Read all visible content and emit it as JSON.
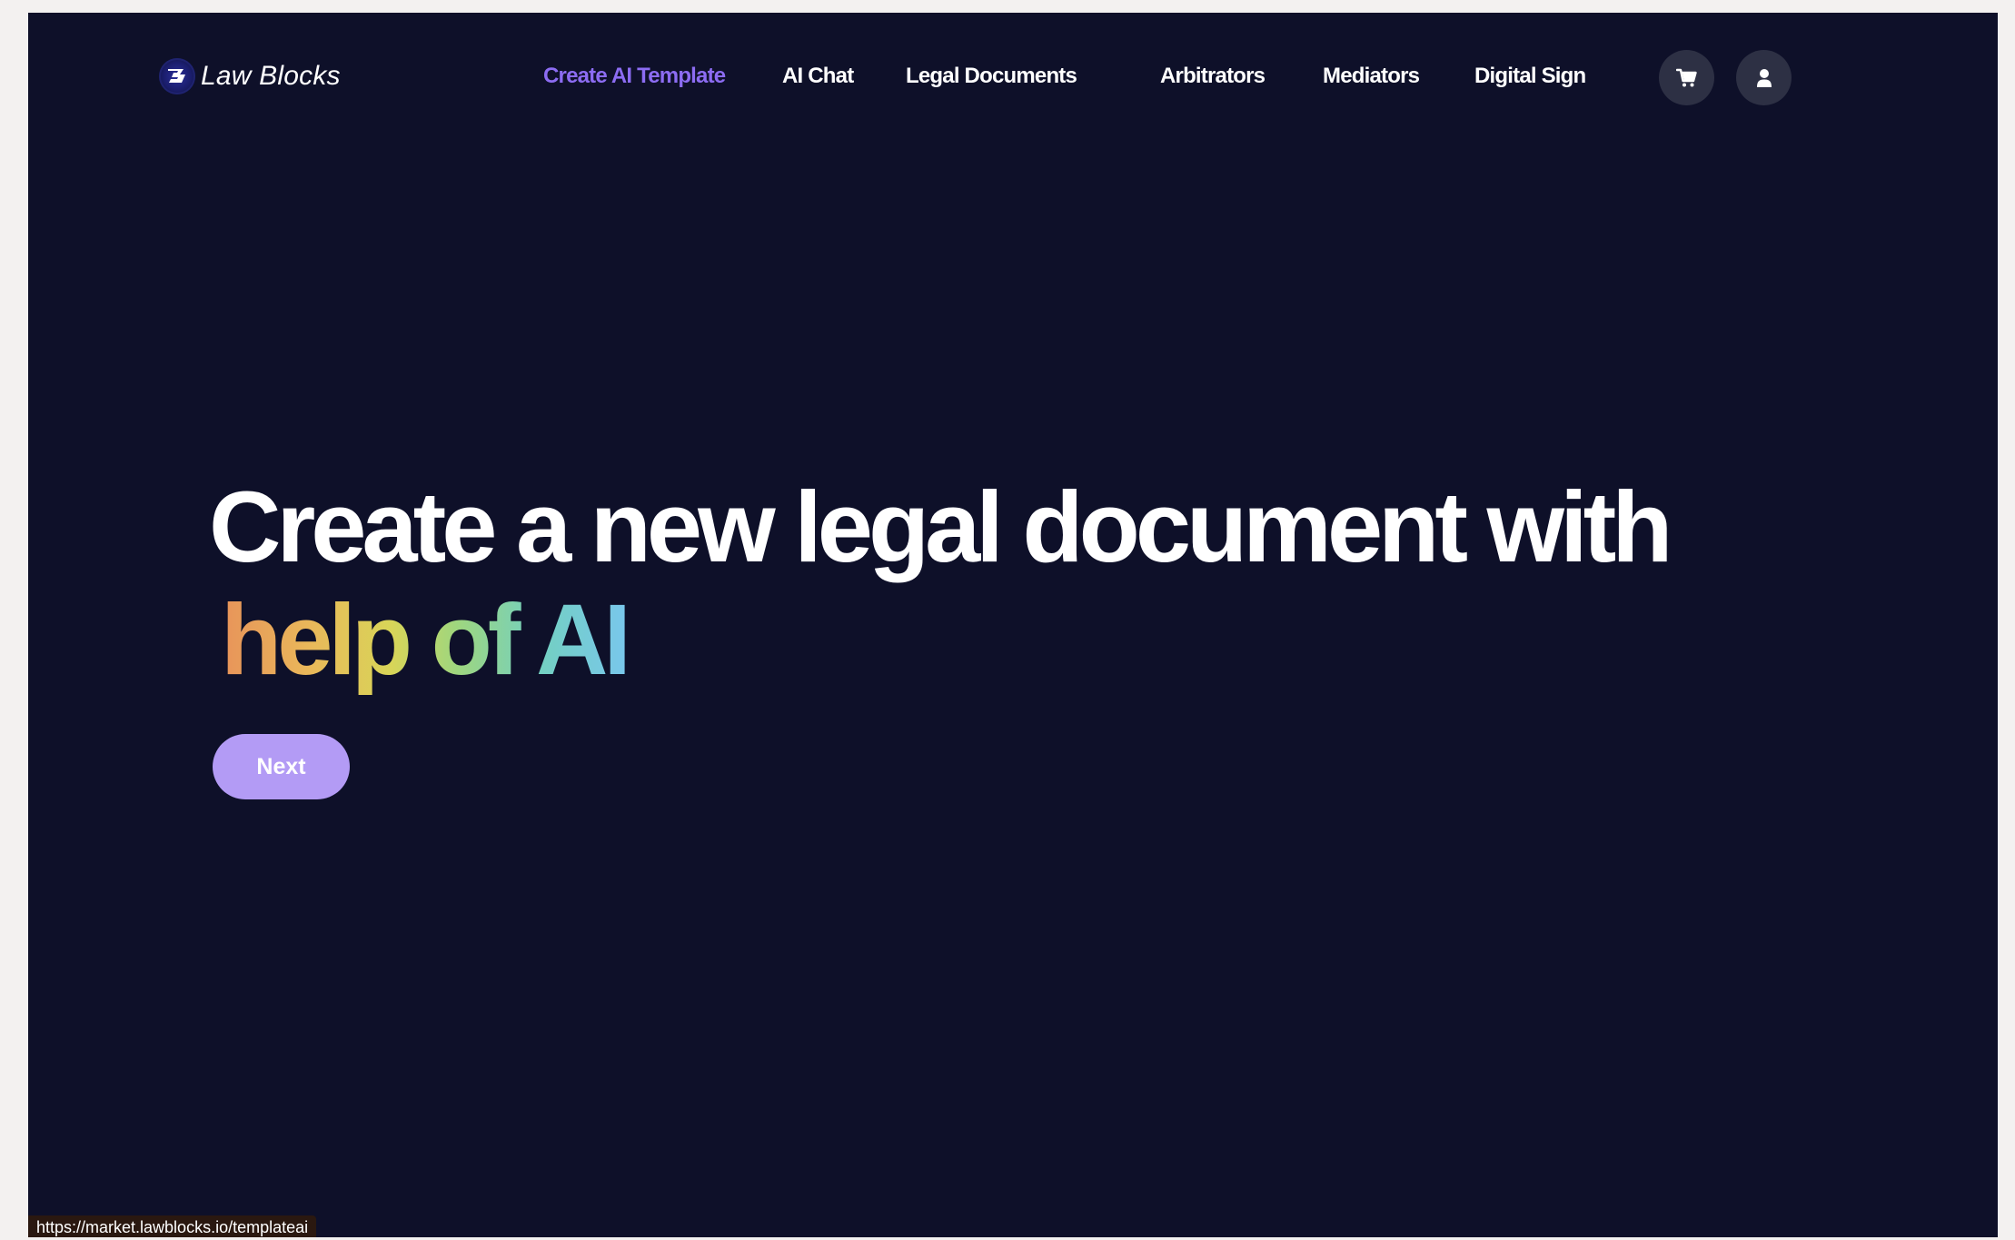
{
  "brand": {
    "name": "Law Blocks"
  },
  "nav": {
    "items": [
      {
        "label": "Create AI Template",
        "active": true
      },
      {
        "label": "AI Chat",
        "active": false
      },
      {
        "label": "Legal Documents",
        "active": false
      },
      {
        "label": "Arbitrators",
        "active": false
      },
      {
        "label": "Mediators",
        "active": false
      },
      {
        "label": "Digital Sign",
        "active": false
      }
    ],
    "actions": [
      {
        "icon": "cart-icon"
      },
      {
        "icon": "user-icon"
      }
    ]
  },
  "hero": {
    "title_line1": "Create a new legal document with",
    "title_highlight": "help of AI",
    "next_label": "Next"
  },
  "status_bar": {
    "url": "https://market.lawblocks.io/templateai"
  },
  "colors": {
    "background": "#0e1029",
    "accent": "#8c6cf2",
    "button": "#b39bf5",
    "icon_button": "#2d3044"
  }
}
